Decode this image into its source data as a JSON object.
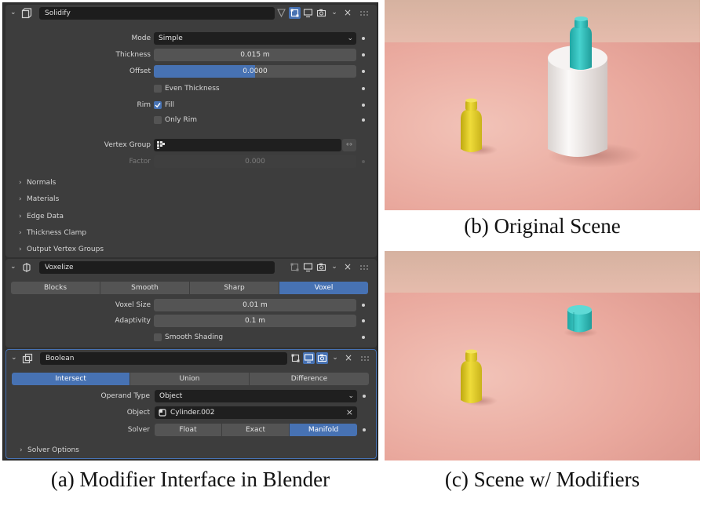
{
  "panel": {
    "solidify": {
      "name": "Solidify",
      "mode_label": "Mode",
      "mode_value": "Simple",
      "thickness_label": "Thickness",
      "thickness_value": "0.015 m",
      "offset_label": "Offset",
      "offset_value": "0.0000",
      "even_thickness_label": "Even Thickness",
      "rim_label": "Rim",
      "fill_label": "Fill",
      "only_rim_label": "Only Rim",
      "vertex_group_label": "Vertex Group",
      "vertex_group_value": "",
      "factor_label": "Factor",
      "factor_value": "0.000",
      "subpanels": [
        "Normals",
        "Materials",
        "Edge Data",
        "Thickness Clamp",
        "Output Vertex Groups"
      ]
    },
    "voxelize": {
      "name": "Voxelize",
      "modes": [
        "Blocks",
        "Smooth",
        "Sharp",
        "Voxel"
      ],
      "active_mode": "Voxel",
      "voxel_size_label": "Voxel Size",
      "voxel_size_value": "0.01 m",
      "adaptivity_label": "Adaptivity",
      "adaptivity_value": "0.1 m",
      "smooth_shading_label": "Smooth Shading"
    },
    "boolean": {
      "name": "Boolean",
      "operations": [
        "Intersect",
        "Union",
        "Difference"
      ],
      "active_operation": "Intersect",
      "operand_type_label": "Operand Type",
      "operand_type_value": "Object",
      "object_label": "Object",
      "object_value": "Cylinder.002",
      "solver_label": "Solver",
      "solvers": [
        "Float",
        "Exact",
        "Manifold"
      ],
      "active_solver": "Manifold",
      "solver_options_label": "Solver Options"
    }
  },
  "captions": {
    "a": "(a) Modifier Interface in Blender",
    "b": "(b) Original Scene",
    "c": "(c) Scene w/ Modifiers"
  },
  "colors": {
    "accent": "#4772b3",
    "panel_bg": "#3d3d3d",
    "floor": "#e7a49a",
    "wall": "#d9b3a2",
    "yellow_bottle": "#e3cf2a",
    "teal_bottle": "#2fbfbc",
    "white_cylinder": "#f1eeec"
  },
  "icons": {
    "solidify": "solidify-modifier-icon",
    "voxelize": "voxelize-modifier-icon",
    "boolean": "boolean-modifier-icon"
  }
}
